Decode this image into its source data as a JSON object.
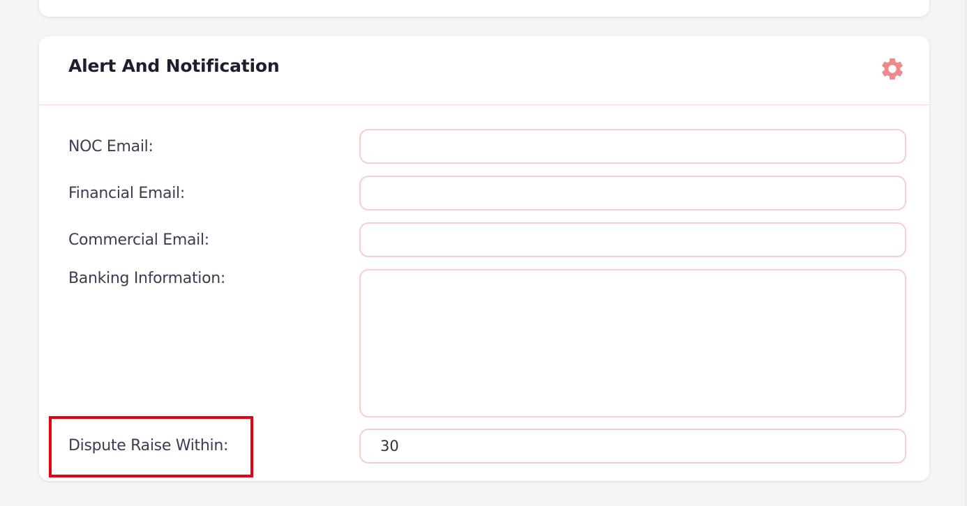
{
  "section": {
    "title": "Alert And Notification",
    "settings_icon": "gear-icon",
    "accent_color": "#f08080"
  },
  "fields": {
    "noc_email": {
      "label": "NOC Email:",
      "value": ""
    },
    "financial_email": {
      "label": "Financial Email:",
      "value": ""
    },
    "commercial_email": {
      "label": "Commercial Email:",
      "value": ""
    },
    "banking_information": {
      "label": "Banking Information:",
      "value": ""
    },
    "dispute_raise_within": {
      "label": "Dispute Raise Within:",
      "value": "30"
    }
  },
  "highlight_color": "#e60012"
}
